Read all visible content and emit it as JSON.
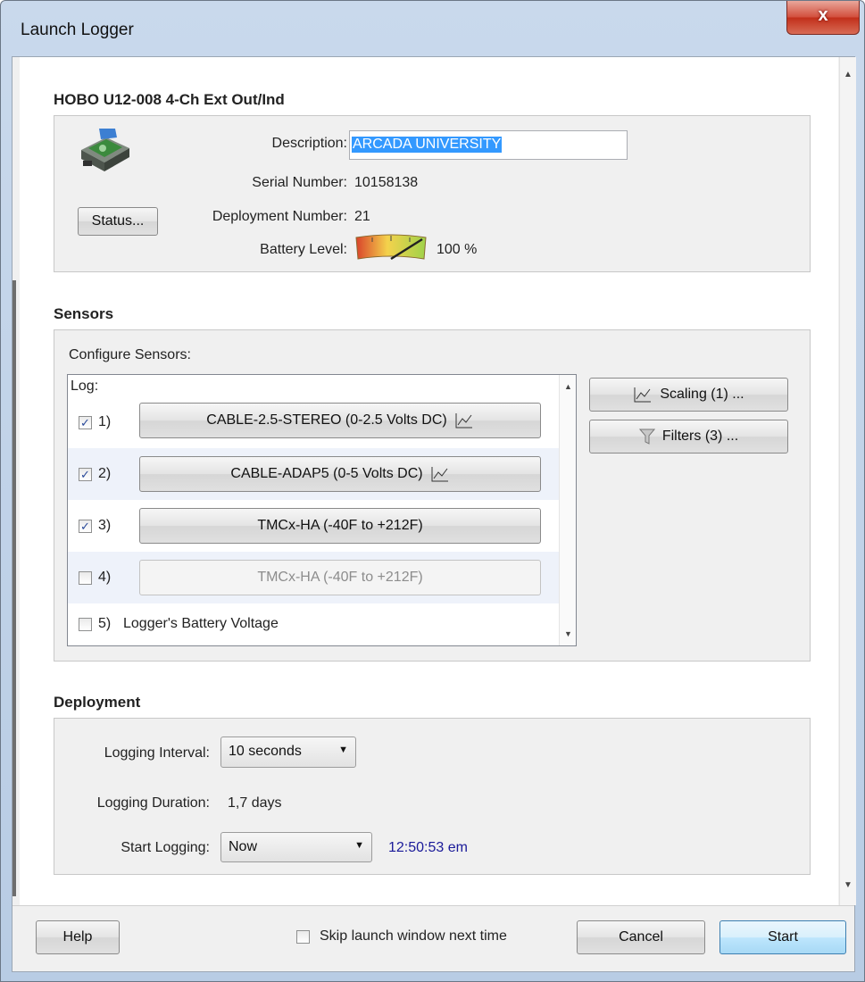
{
  "window": {
    "title": "Launch Logger",
    "close_label": "x"
  },
  "device": {
    "title": "HOBO U12-008 4-Ch Ext Out/Ind",
    "description_label": "Description:",
    "description_value": "ARCADA UNIVERSITY",
    "serial_label": "Serial Number:",
    "serial_value": "10158138",
    "deployment_label": "Deployment Number:",
    "deployment_value": "21",
    "battery_label": "Battery Level:",
    "battery_value": "100 %",
    "battery_level": 1.0,
    "status_button": "Status..."
  },
  "sensors": {
    "title": "Sensors",
    "configure_label": "Configure Sensors:",
    "log_label": "Log:",
    "items": [
      {
        "number": "1)",
        "label": "CABLE-2.5-STEREO (0-2.5 Volts DC)",
        "checked": true,
        "enabled": true,
        "scaled": true
      },
      {
        "number": "2)",
        "label": "CABLE-ADAP5 (0-5 Volts DC)",
        "checked": true,
        "enabled": true,
        "scaled": true
      },
      {
        "number": "3)",
        "label": "TMCx-HA (-40F to +212F)",
        "checked": true,
        "enabled": true,
        "scaled": false
      },
      {
        "number": "4)",
        "label": "TMCx-HA (-40F to +212F)",
        "checked": false,
        "enabled": false,
        "scaled": false
      },
      {
        "number": "5)",
        "label": "Logger's Battery Voltage",
        "checked": false,
        "enabled": true,
        "scaled": false
      }
    ],
    "scaling_button": "Scaling (1) ...",
    "filters_button": "Filters (3) ..."
  },
  "deployment": {
    "title": "Deployment",
    "interval_label": "Logging Interval:",
    "interval_value": "10 seconds",
    "duration_label": "Logging Duration:",
    "duration_value": "1,7 days",
    "start_label": "Start Logging:",
    "start_value": "Now",
    "start_time": "12:50:53 em"
  },
  "footer": {
    "help_button": "Help",
    "skip_label": "Skip launch window next time",
    "skip_checked": false,
    "cancel_button": "Cancel",
    "start_button": "Start"
  },
  "colors": {
    "accent": "#3399ff",
    "time_text": "#1a1a99",
    "row_alt": "#eef2fa"
  }
}
